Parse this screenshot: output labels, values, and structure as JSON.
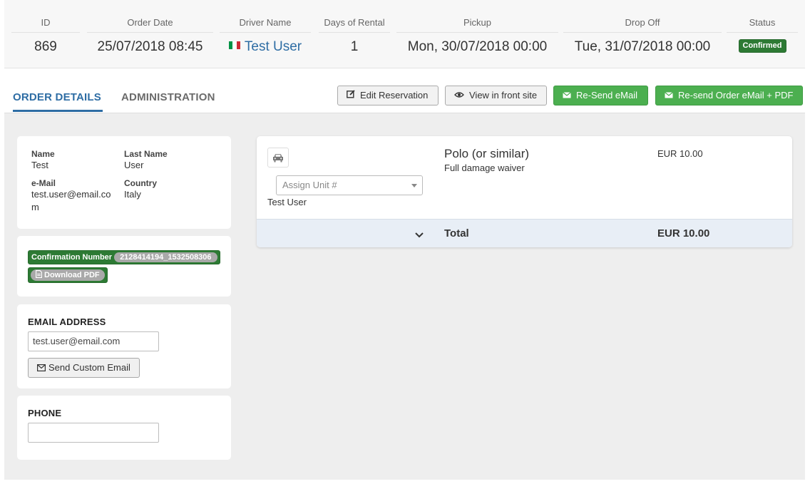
{
  "summary": {
    "id_label": "ID",
    "id_value": "869",
    "order_date_label": "Order Date",
    "order_date_value": "25/07/2018 08:45",
    "driver_label": "Driver Name",
    "driver_value": "Test User",
    "days_label": "Days of Rental",
    "days_value": "1",
    "pickup_label": "Pickup",
    "pickup_value": "Mon, 30/07/2018 00:00",
    "dropoff_label": "Drop Off",
    "dropoff_value": "Tue, 31/07/2018 00:00",
    "status_label": "Status",
    "status_value": "Confirmed",
    "driver_flag_icon": "italy-flag-icon"
  },
  "tabs": {
    "order_details": "ORDER DETAILS",
    "administration": "ADMINISTRATION"
  },
  "toolbar": {
    "edit_label": "Edit Reservation",
    "view_label": "View in front site",
    "resend_label": "Re-Send eMail",
    "resend_pdf_label": "Re-send Order eMail + PDF"
  },
  "customer": {
    "name_label": "Name",
    "name_value": "Test",
    "last_name_label": "Last Name",
    "last_name_value": "User",
    "email_label": "e-Mail",
    "email_value_line1": "test.user@email.co",
    "email_value_line2": "m",
    "country_label": "Country",
    "country_value": "Italy"
  },
  "confirmation": {
    "label": "Confirmation Number",
    "number": "2128414194_1532508306",
    "download_label": "Download PDF"
  },
  "email_section": {
    "title": "EMAIL ADDRESS",
    "value": "test.user@email.com",
    "send_label": "Send Custom Email"
  },
  "phone_section": {
    "title": "PHONE",
    "value": ""
  },
  "order": {
    "car_name": "Polo (or similar)",
    "extra": "Full damage waiver",
    "price": "EUR 10.00",
    "assign_placeholder": "Assign Unit #",
    "driver": "Test User",
    "total_label": "Total",
    "total_value": "EUR 10.00"
  },
  "colors": {
    "accent": "#2e6da4",
    "success": "#4caf50",
    "confirmed": "#2d7a34"
  }
}
